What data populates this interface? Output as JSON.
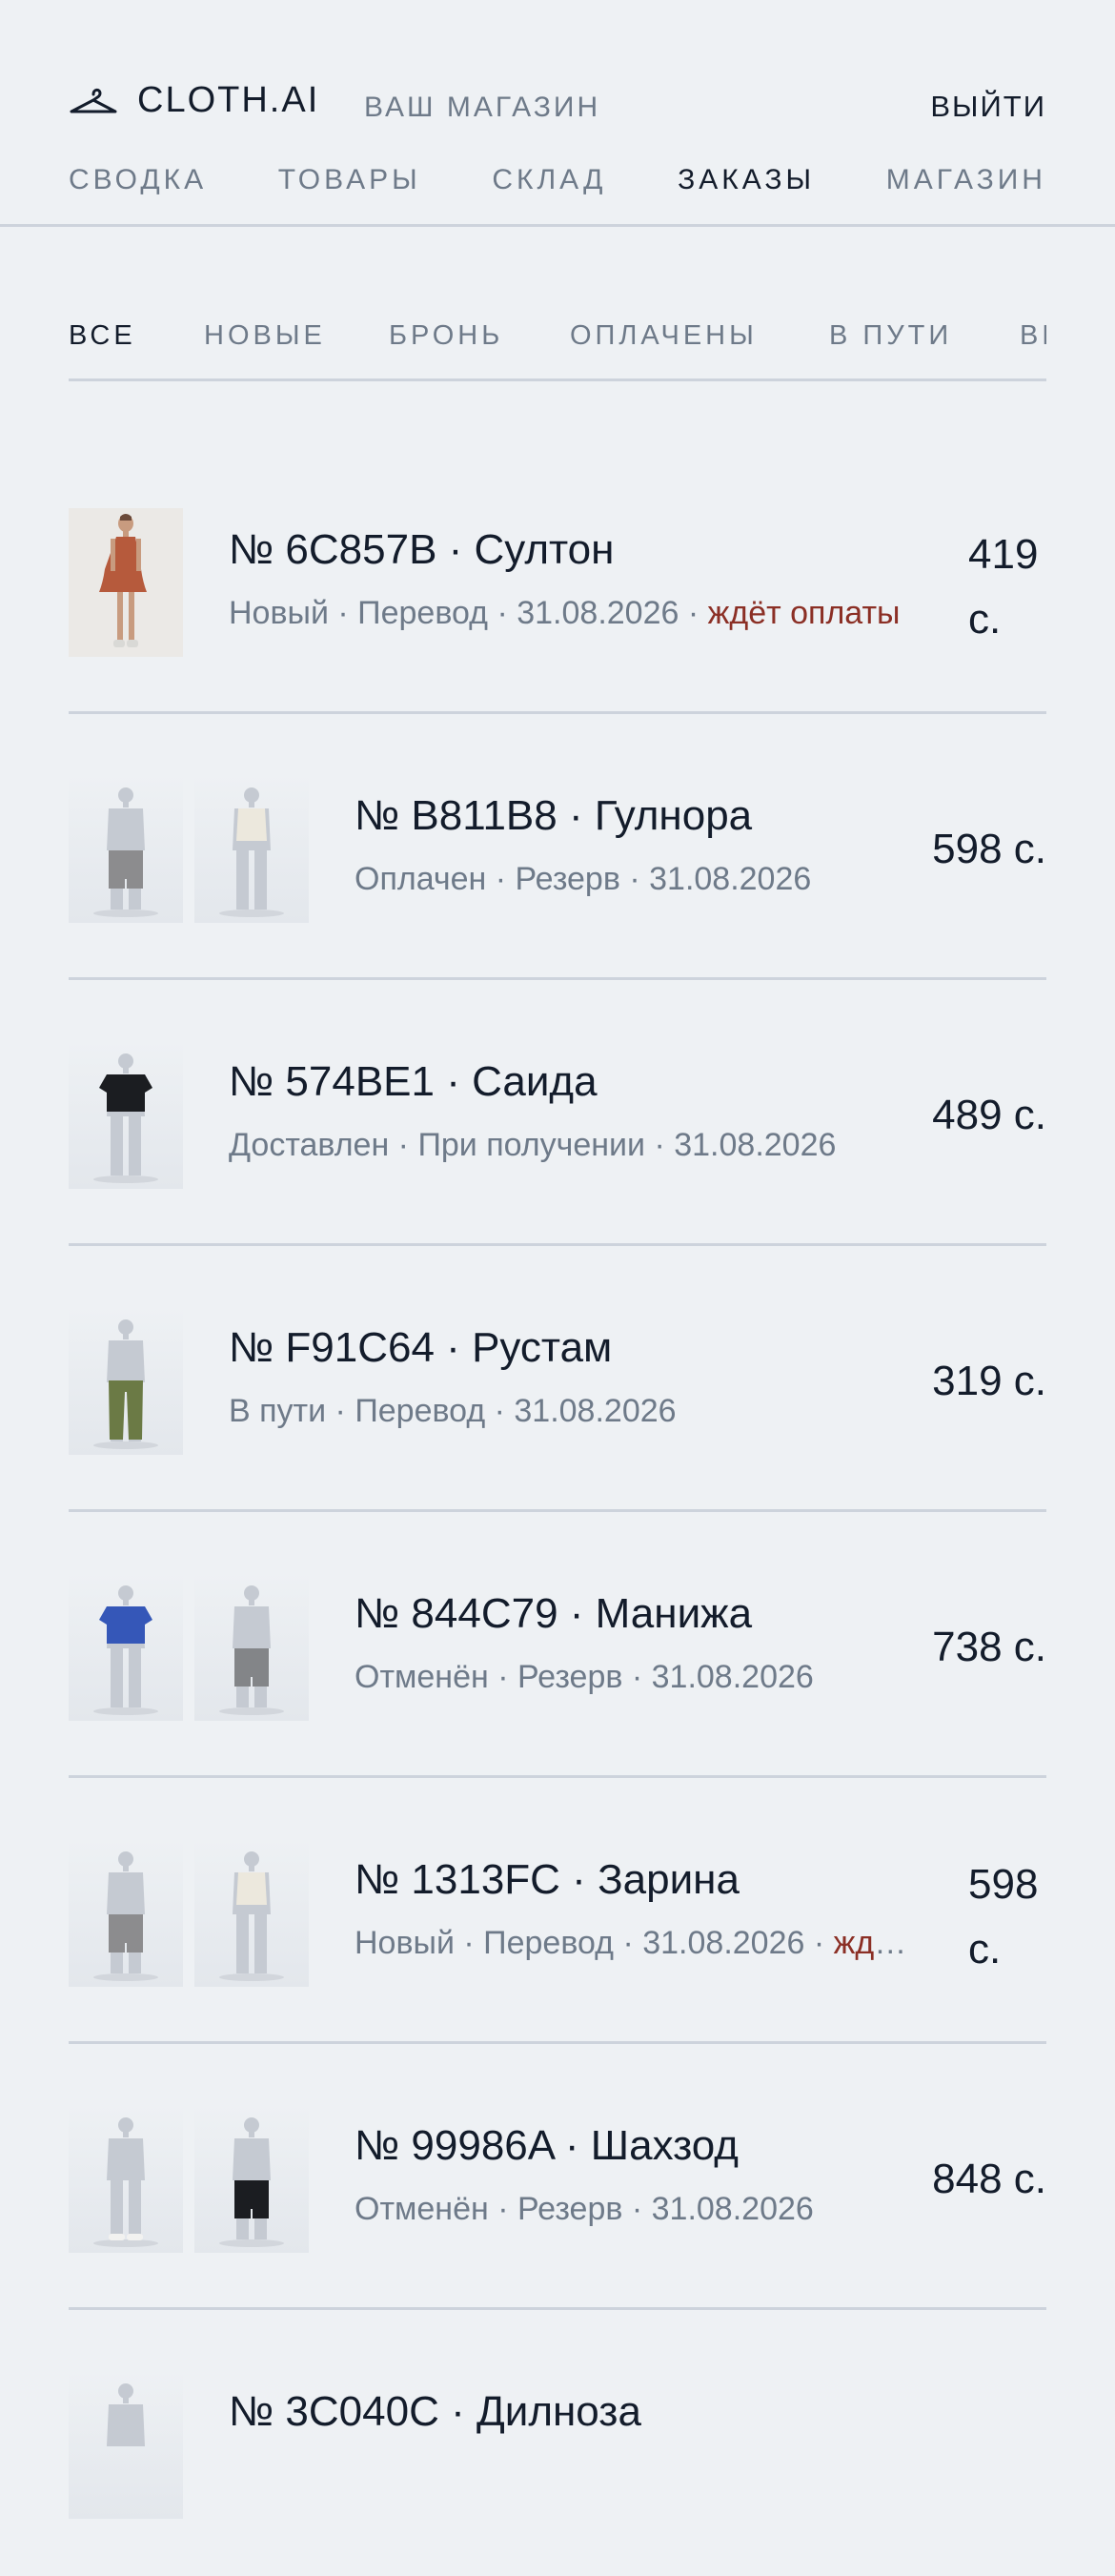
{
  "header": {
    "brand": "CLOTH.AI",
    "store_label": "ВАШ МАГАЗИН",
    "logout": "ВЫЙТИ",
    "logo_icon": "hanger-icon"
  },
  "nav": [
    "СВОДКА",
    "ТОВАРЫ",
    "СКЛАД",
    "ЗАКАЗЫ",
    "МАГАЗИН"
  ],
  "nav_active": "ЗАКАЗЫ",
  "filters": [
    "ВСЕ",
    "НОВЫЕ",
    "БРОНЬ",
    "ОПЛАЧЕНЫ",
    "В ПУТИ",
    "ВЫДАНЫ"
  ],
  "filter_active": "ВСЕ",
  "colors": {
    "warning": "#8b2f25",
    "muted": "#6e7a89",
    "text": "#131c2b",
    "background": "#eef1f4"
  },
  "orders": [
    {
      "title": "№ 6C857B · Султон",
      "meta": "Новый · Перевод · 31.08.2026 · ",
      "warning": "ждёт оплаты",
      "price": "419 с.",
      "thumbs": [
        "model-photo"
      ]
    },
    {
      "title": "№ B811B8 · Гулнора",
      "meta": "Оплачен · Резерв · 31.08.2026",
      "warning": "",
      "price": "598 с.",
      "thumbs": [
        "gray-shorts",
        "white-top"
      ]
    },
    {
      "title": "№ 574BE1 · Саида",
      "meta": "Доставлен · При получении · 31.08.2026",
      "warning": "",
      "price": "489 с.",
      "thumbs": [
        "black-tshirt"
      ]
    },
    {
      "title": "№ F91C64 · Рустам",
      "meta": "В пути · Перевод · 31.08.2026",
      "warning": "",
      "price": "319 с.",
      "thumbs": [
        "olive-pants"
      ]
    },
    {
      "title": "№ 844C79 · Манижа",
      "meta": "Отменён · Резерв · 31.08.2026",
      "warning": "",
      "price": "738 с.",
      "thumbs": [
        "blue-tshirt",
        "gray-shorts"
      ]
    },
    {
      "title": "№ 1313FC · Зарина",
      "meta": "Новый · Перевод · 31.08.2026 · ",
      "warning": "ждёт оплаты",
      "price": "598 с.",
      "thumbs": [
        "gray-shorts",
        "white-top"
      ]
    },
    {
      "title": "№ 99986A · Шахзод",
      "meta": "Отменён · Резерв · 31.08.2026",
      "warning": "",
      "price": "848 с.",
      "thumbs": [
        "white-shoes",
        "black-shorts"
      ]
    },
    {
      "title": "№ 3C040C · Дилноза",
      "meta": "",
      "warning": "",
      "price": "",
      "thumbs": [
        "mannequin"
      ]
    }
  ]
}
